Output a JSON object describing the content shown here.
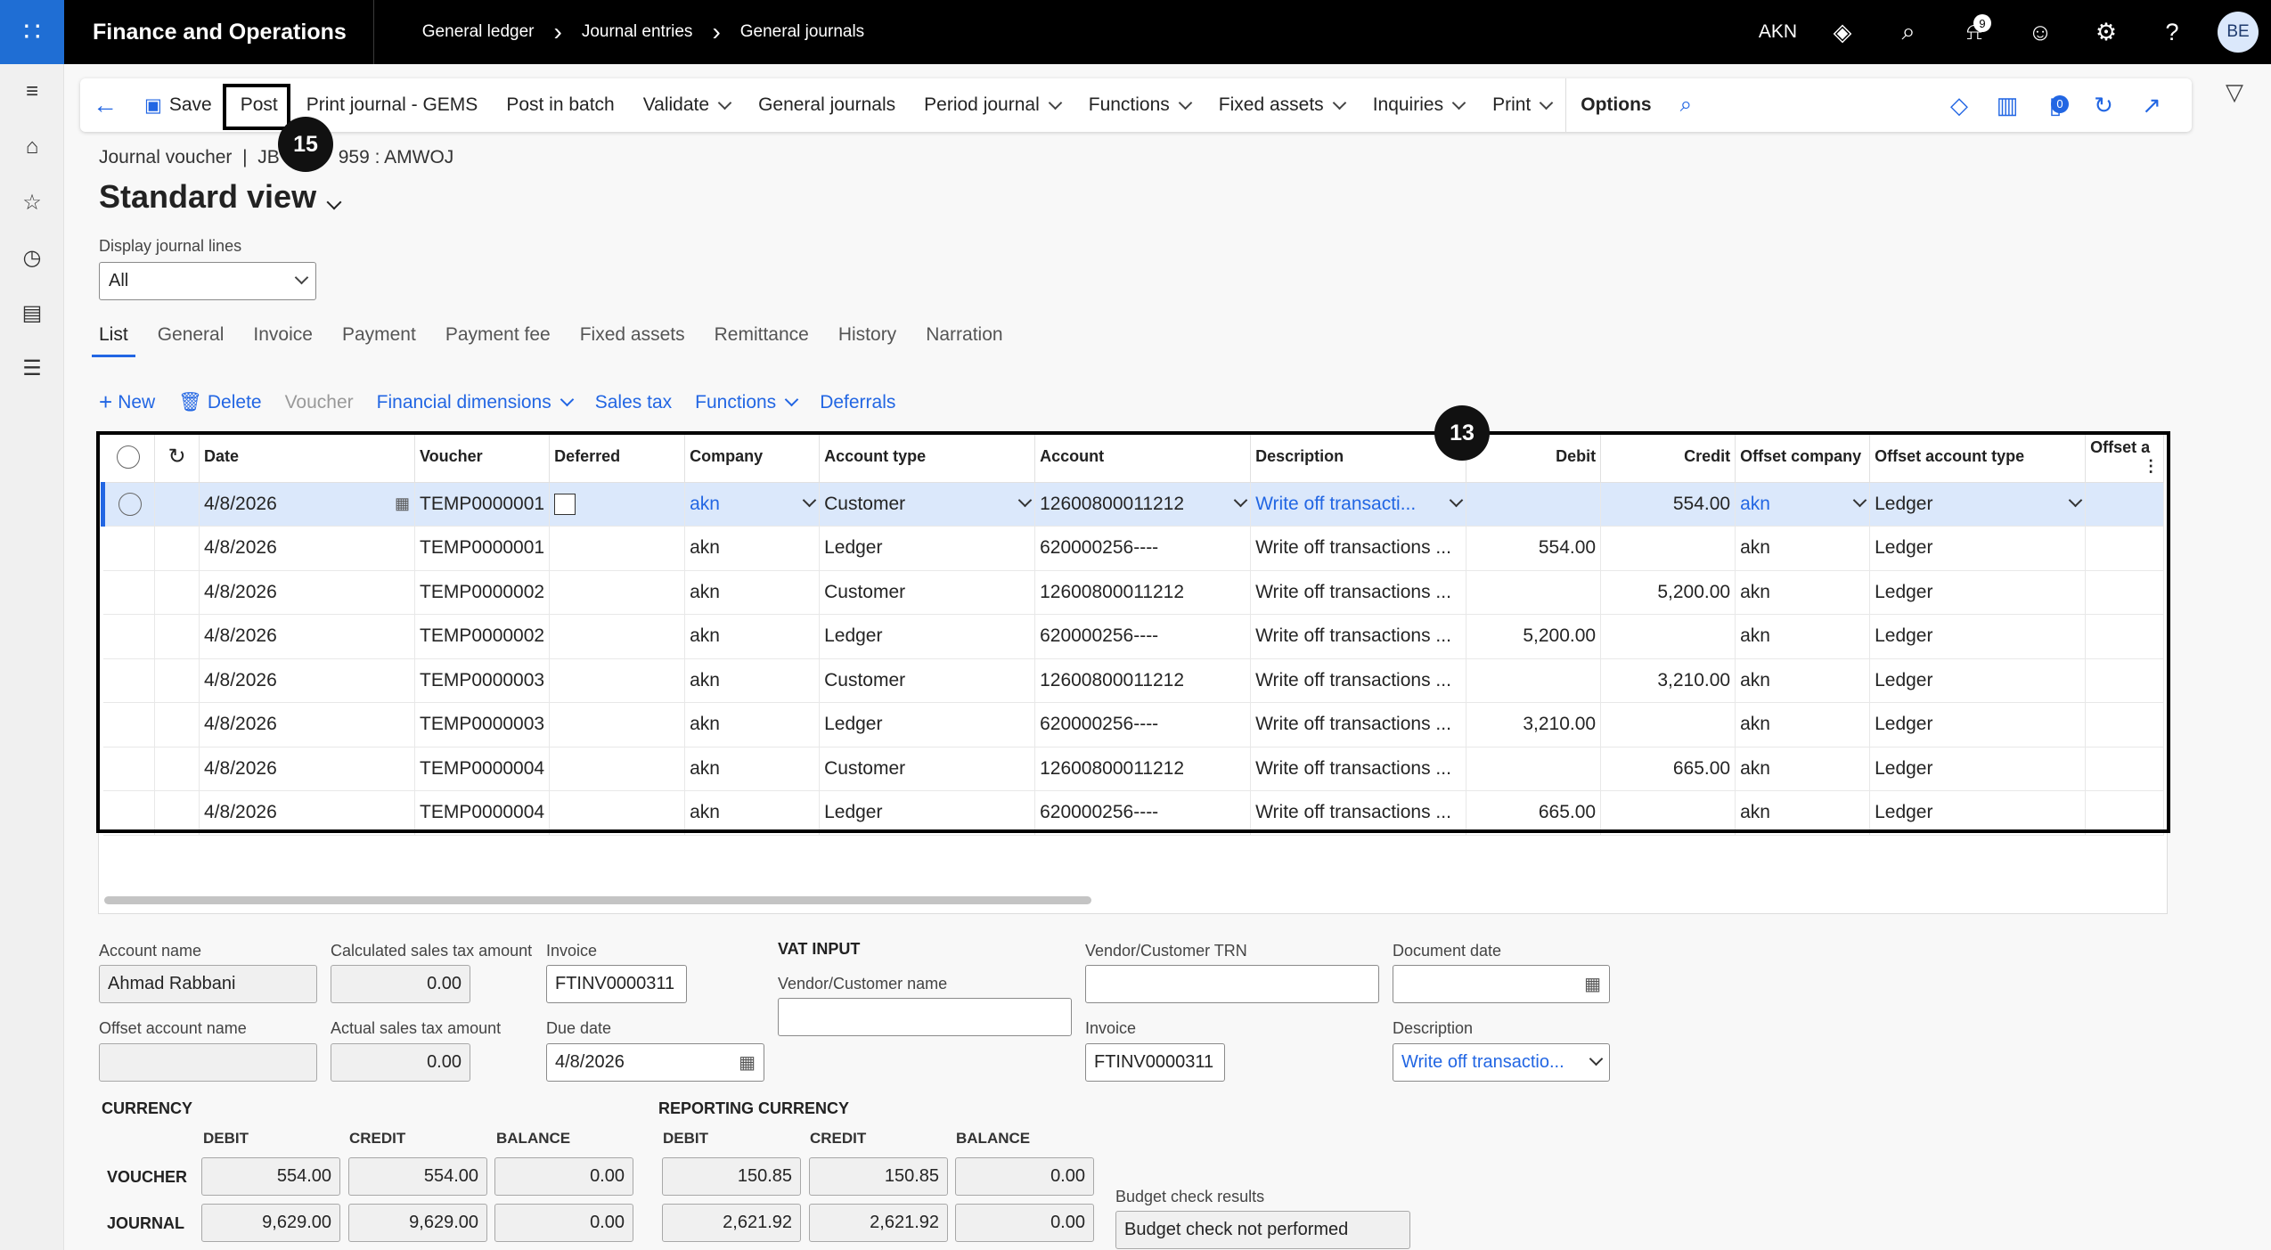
{
  "topbar": {
    "app_name": "Finance and Operations",
    "breadcrumbs": [
      "General ledger",
      "Journal entries",
      "General journals"
    ],
    "company": "AKN",
    "notification_count": "9",
    "user_initials": "BE"
  },
  "actions": {
    "save": "Save",
    "post": "Post",
    "print_journal": "Print journal - GEMS",
    "post_in_batch": "Post in batch",
    "validate": "Validate",
    "general_journals": "General journals",
    "period_journal": "Period journal",
    "functions": "Functions",
    "fixed_assets": "Fixed assets",
    "inquiries": "Inquiries",
    "print": "Print",
    "options": "Options",
    "attachments_count": "0"
  },
  "callouts": {
    "post": "15",
    "grid": "13"
  },
  "header": {
    "journal_voucher": "Journal voucher  |  JB",
    "journal_id_suffix": "959 : AMWOJ",
    "view_name": "Standard view"
  },
  "display_lines": {
    "label": "Display journal lines",
    "value": "All"
  },
  "tabs": [
    "List",
    "General",
    "Invoice",
    "Payment",
    "Payment fee",
    "Fixed assets",
    "Remittance",
    "History",
    "Narration"
  ],
  "grid_actions": {
    "new": "New",
    "delete": "Delete",
    "voucher": "Voucher",
    "financial_dimensions": "Financial dimensions",
    "sales_tax": "Sales tax",
    "functions": "Functions",
    "deferrals": "Deferrals"
  },
  "grid": {
    "columns": [
      "Date",
      "Voucher",
      "Deferred",
      "Company",
      "Account type",
      "Account",
      "Description",
      "Debit",
      "Credit",
      "Offset company",
      "Offset account type",
      "Offset a"
    ],
    "rows": [
      {
        "date": "4/8/2026",
        "voucher": "TEMP0000001",
        "company": "akn",
        "account_type": "Customer",
        "account": "12600800011212",
        "description": "Write off transacti...",
        "debit": "",
        "credit": "554.00",
        "offset_company": "akn",
        "offset_type": "Ledger"
      },
      {
        "date": "4/8/2026",
        "voucher": "TEMP0000001",
        "company": "akn",
        "account_type": "Ledger",
        "account": "620000256----",
        "description": "Write off transactions ...",
        "debit": "554.00",
        "credit": "",
        "offset_company": "akn",
        "offset_type": "Ledger"
      },
      {
        "date": "4/8/2026",
        "voucher": "TEMP0000002",
        "company": "akn",
        "account_type": "Customer",
        "account": "12600800011212",
        "description": "Write off transactions ...",
        "debit": "",
        "credit": "5,200.00",
        "offset_company": "akn",
        "offset_type": "Ledger"
      },
      {
        "date": "4/8/2026",
        "voucher": "TEMP0000002",
        "company": "akn",
        "account_type": "Ledger",
        "account": "620000256----",
        "description": "Write off transactions ...",
        "debit": "5,200.00",
        "credit": "",
        "offset_company": "akn",
        "offset_type": "Ledger"
      },
      {
        "date": "4/8/2026",
        "voucher": "TEMP0000003",
        "company": "akn",
        "account_type": "Customer",
        "account": "12600800011212",
        "description": "Write off transactions ...",
        "debit": "",
        "credit": "3,210.00",
        "offset_company": "akn",
        "offset_type": "Ledger"
      },
      {
        "date": "4/8/2026",
        "voucher": "TEMP0000003",
        "company": "akn",
        "account_type": "Ledger",
        "account": "620000256----",
        "description": "Write off transactions ...",
        "debit": "3,210.00",
        "credit": "",
        "offset_company": "akn",
        "offset_type": "Ledger"
      },
      {
        "date": "4/8/2026",
        "voucher": "TEMP0000004",
        "company": "akn",
        "account_type": "Customer",
        "account": "12600800011212",
        "description": "Write off transactions ...",
        "debit": "",
        "credit": "665.00",
        "offset_company": "akn",
        "offset_type": "Ledger"
      },
      {
        "date": "4/8/2026",
        "voucher": "TEMP0000004",
        "company": "akn",
        "account_type": "Ledger",
        "account": "620000256----",
        "description": "Write off transactions ...",
        "debit": "665.00",
        "credit": "",
        "offset_company": "akn",
        "offset_type": "Ledger"
      }
    ]
  },
  "details": {
    "account_name_label": "Account name",
    "account_name": "Ahmad Rabbani",
    "offset_account_name_label": "Offset account name",
    "offset_account_name": "",
    "calc_tax_label": "Calculated sales tax amount",
    "calc_tax": "0.00",
    "actual_tax_label": "Actual sales tax amount",
    "actual_tax": "0.00",
    "invoice_label": "Invoice",
    "invoice": "FTINV0000311",
    "due_date_label": "Due date",
    "due_date": "4/8/2026",
    "vat_input": "VAT INPUT",
    "vendor_name_label": "Vendor/Customer name",
    "vendor_name": "",
    "vendor_trn_label": "Vendor/Customer TRN",
    "vendor_trn": "",
    "vat_invoice_label": "Invoice",
    "vat_invoice": "FTINV0000311",
    "doc_date_label": "Document date",
    "doc_date": "",
    "description_label": "Description",
    "description": "Write off transactio...",
    "budget_label": "Budget check results",
    "budget": "Budget check not performed"
  },
  "currency": {
    "title": "CURRENCY",
    "reporting_title": "REPORTING CURRENCY",
    "debit": "DEBIT",
    "credit": "CREDIT",
    "balance": "BALANCE",
    "voucher_label": "VOUCHER",
    "journal_label": "JOURNAL",
    "voucher": {
      "debit": "554.00",
      "credit": "554.00",
      "balance": "0.00"
    },
    "journal": {
      "debit": "9,629.00",
      "credit": "9,629.00",
      "balance": "0.00"
    },
    "rep_voucher": {
      "debit": "150.85",
      "credit": "150.85",
      "balance": "0.00"
    },
    "rep_journal": {
      "debit": "2,621.92",
      "credit": "2,621.92",
      "balance": "0.00"
    }
  }
}
